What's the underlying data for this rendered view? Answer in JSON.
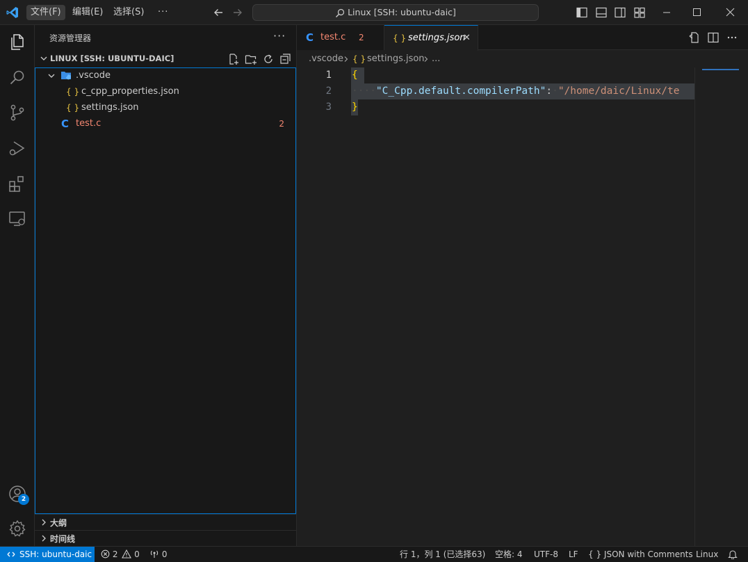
{
  "title_bar": {
    "menus": [
      "文件(F)",
      "编辑(E)",
      "选择(S)"
    ],
    "more": "···",
    "command_center": "Linux [SSH: ubuntu-daic]"
  },
  "activity_bar": {
    "accounts_badge": "2"
  },
  "sidebar": {
    "title": "资源管理器",
    "more": "···",
    "workspace": "LINUX [SSH: UBUNTU-DAIC]",
    "tree": [
      {
        "name": ".vscode",
        "type": "folder"
      },
      {
        "name": "c_cpp_properties.json",
        "type": "json",
        "icon": "{ }"
      },
      {
        "name": "settings.json",
        "type": "json",
        "icon": "{ }"
      },
      {
        "name": "test.c",
        "type": "c",
        "icon": "C",
        "errors": "2"
      }
    ],
    "outline": "大纲",
    "timeline": "时间线"
  },
  "tabs": [
    {
      "label": "test.c",
      "icon": "C",
      "errors": "2"
    },
    {
      "label": "settings.json",
      "icon": "{ }",
      "close": "✕"
    }
  ],
  "breadcrumb": {
    "folder": ".vscode",
    "file_icon": "{ }",
    "file": "settings.json",
    "more": "..."
  },
  "editor": {
    "line_numbers": [
      "1",
      "2",
      "3"
    ],
    "line1": "{",
    "line2_key": "\"C_Cpp.default.compilerPath\"",
    "line2_colon": ":",
    "line2_value": "\"/home/daic/Linux/te",
    "line3": "}"
  },
  "status_bar": {
    "remote": "SSH: ubuntu-daic",
    "errors": "2",
    "warnings": "0",
    "ports": "0",
    "position": "行 1，列 1 (已选择63)",
    "spaces": "空格: 4",
    "encoding": "UTF-8",
    "eol": "LF",
    "language_icon": "{ }",
    "language": "JSON with Comments",
    "platform": "Linux"
  },
  "colors": {
    "accent": "#0078d4",
    "error": "#f48771",
    "json_icon": "#e8c341",
    "c_icon": "#3794ff"
  }
}
